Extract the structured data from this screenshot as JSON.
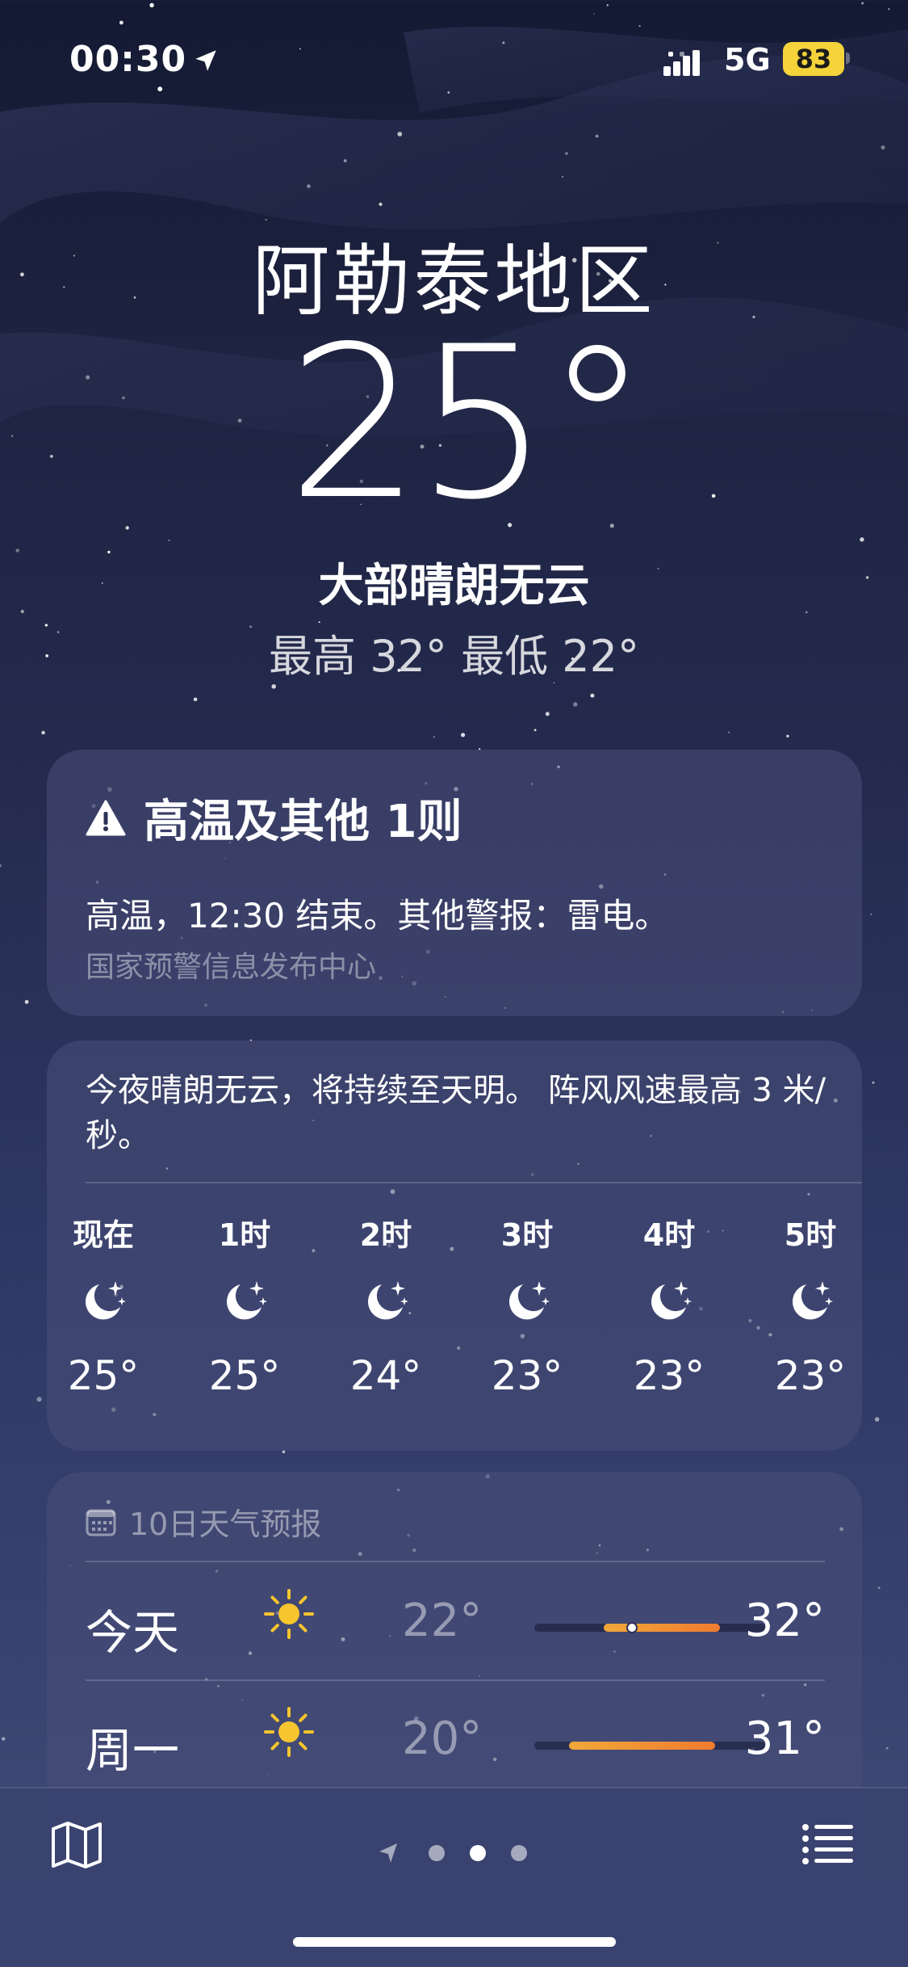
{
  "status_bar": {
    "time": "00:30",
    "network": "5G",
    "battery": "83",
    "battery_color": "#f5d33a"
  },
  "current": {
    "location": "阿勒泰地区",
    "temperature": "25°",
    "condition": "大部晴朗无云",
    "high_low": "最高 32° 最低 22°"
  },
  "alert": {
    "icon": "warning-triangle-icon",
    "title": "高温及其他 1则",
    "body": "高温，12:30 结束。其他警报：雷电。",
    "source": "国家预警信息发布中心"
  },
  "hourly": {
    "summary": "今夜晴朗无云，将持续至天明。 阵风风速最高 3 米/秒。",
    "items": [
      {
        "label": "现在",
        "icon": "moon-stars-icon",
        "temp": "25°"
      },
      {
        "label": "1时",
        "icon": "moon-stars-icon",
        "temp": "25°"
      },
      {
        "label": "2时",
        "icon": "moon-stars-icon",
        "temp": "24°"
      },
      {
        "label": "3时",
        "icon": "moon-stars-icon",
        "temp": "23°"
      },
      {
        "label": "4时",
        "icon": "moon-stars-icon",
        "temp": "23°"
      },
      {
        "label": "5时",
        "icon": "moon-stars-icon",
        "temp": "23°"
      }
    ]
  },
  "forecast": {
    "header": "10日天气预报",
    "icon": "calendar-icon",
    "days": [
      {
        "day": "今天",
        "icon": "sun-icon",
        "low": "22°",
        "high": "32°",
        "range_start": 0.3,
        "range_end": 0.8,
        "current_marker": 0.42
      },
      {
        "day": "周一",
        "icon": "sun-icon",
        "low": "20°",
        "high": "31°",
        "range_start": 0.15,
        "range_end": 0.78
      }
    ]
  },
  "toolbar": {
    "map_icon": "map-icon",
    "location_icon": "location-arrow-icon",
    "list_icon": "list-icon",
    "page_count": 3,
    "active_page": 1
  },
  "colors": {
    "sun": "#f7c52d",
    "bar_warm": "#f0a83a",
    "bar_hot": "#f07b2f",
    "bar_track": "#181c36"
  }
}
